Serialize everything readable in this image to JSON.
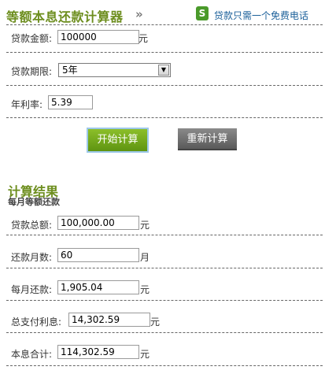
{
  "header": {
    "title": "等额本息还款计算器",
    "chevrons": "»",
    "phone_icon": "phone-badge-icon",
    "phone_link": "贷款只需一个免费电话"
  },
  "form": {
    "amount_label": "贷款金额:",
    "amount_value": "100000",
    "amount_unit": "元",
    "term_label": "贷款期限:",
    "term_value": "5年",
    "rate_label": "年利率:",
    "rate_value": "5.39",
    "start_button": "开始计算",
    "reset_button": "重新计算"
  },
  "results": {
    "title": "计算结果",
    "subtitle": "每月等额还款",
    "total_loan_label": "贷款总额:",
    "total_loan_value": "100,000.00",
    "total_loan_unit": "元",
    "months_label": "还款月数:",
    "months_value": "60",
    "months_unit": "月",
    "monthly_label": "每月还款:",
    "monthly_value": "1,905.04",
    "monthly_unit": "元",
    "interest_label": "总支付利息:",
    "interest_value": "14,302.59",
    "interest_unit": "元",
    "sum_label": "本息合计:",
    "sum_value": "114,302.59",
    "sum_unit": "元"
  }
}
